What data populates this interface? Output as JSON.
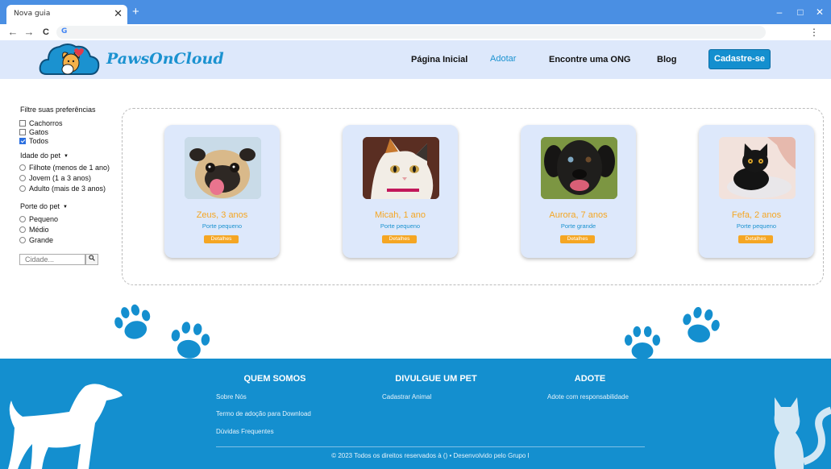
{
  "browser": {
    "tab_title": "Nova guia",
    "tab_close": "✕",
    "new_tab": "+",
    "back": "←",
    "forward": "→",
    "reload": "C",
    "search_engine_icon": "G",
    "menu": "⋮",
    "minimize": "–",
    "maximize": "□",
    "close": "✕"
  },
  "header": {
    "logo_text": "PawsOnCloud",
    "nav": [
      "Página Inicial",
      "Adotar",
      "Encontre uma ONG",
      "Blog"
    ],
    "active_nav": "Adotar",
    "signup_label": "Cadastre-se",
    "accent_color": "#1b92d0"
  },
  "filters": {
    "title": "Filtre suas preferências",
    "species": [
      {
        "label": "Cachorros",
        "checked": false
      },
      {
        "label": "Gatos",
        "checked": false
      },
      {
        "label": "Todos",
        "checked": true
      }
    ],
    "age_heading": "Idade do pet",
    "ages": [
      "Filhote (menos de 1 ano)",
      "Jovem (1 a 3 anos)",
      "Adulto (mais de 3 anos)"
    ],
    "size_heading": "Porte do pet",
    "sizes": [
      "Pequeno",
      "Médio",
      "Grande"
    ],
    "city_placeholder": "Cidade...",
    "city_button_icon": "search-icon"
  },
  "pets": [
    {
      "name": "Zeus, 3 anos",
      "size": "Porte pequeno",
      "button": "Detalhes",
      "kind": "pug"
    },
    {
      "name": "Micah, 1 ano",
      "size": "Porte pequeno",
      "button": "Detalhes",
      "kind": "calico-cat"
    },
    {
      "name": "Aurora, 7 anos",
      "size": "Porte grande",
      "button": "Detalhes",
      "kind": "black-dog"
    },
    {
      "name": "Fefa, 2 anos",
      "size": "Porte pequeno",
      "button": "Detalhes",
      "kind": "black-cat"
    }
  ],
  "footer": {
    "columns": [
      {
        "title": "QUEM SOMOS",
        "links": [
          "Sobre Nós",
          "Termo de adoção para Download",
          "Dúvidas Frequentes"
        ]
      },
      {
        "title": "DIVULGUE UM PET",
        "links": [
          "Cadastrar Animal"
        ]
      },
      {
        "title": "ADOTE",
        "links": [
          "Adote com responsabilidade"
        ]
      }
    ],
    "copyright": "© 2023 Todos os direitos reservados à () • Desenvolvido pelo Grupo I",
    "background_color": "#148fcf"
  }
}
